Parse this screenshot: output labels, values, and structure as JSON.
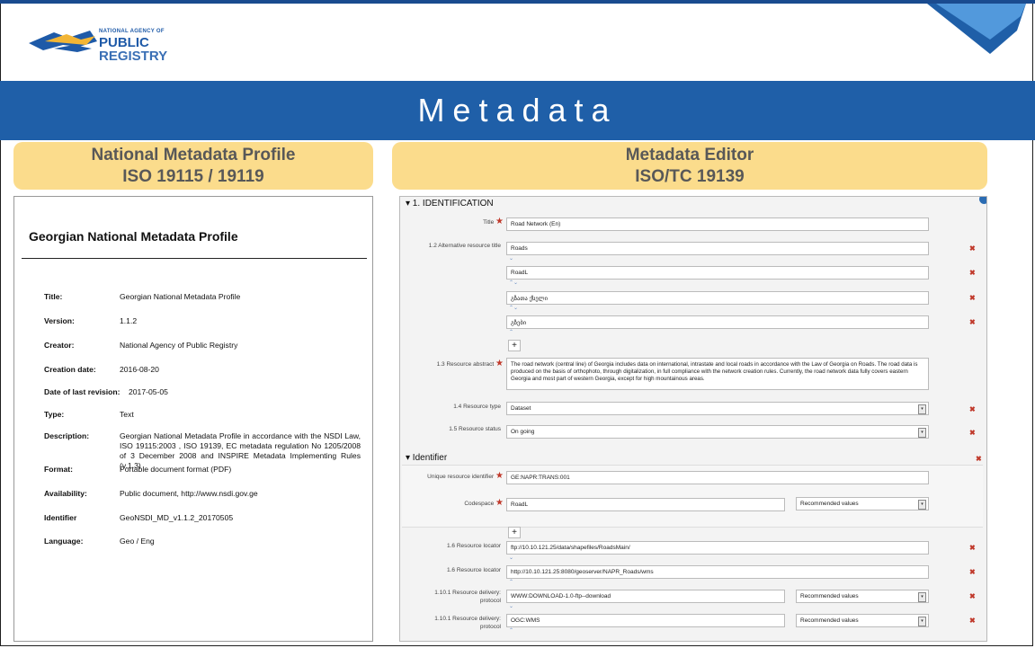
{
  "header": {
    "logo_small": "NATIONAL AGENCY OF",
    "logo_line1": "PUBLIC",
    "logo_line2": "REGISTRY"
  },
  "banner": {
    "title": "Metadata"
  },
  "left_header": {
    "line1": "National Metadata Profile",
    "line2": "ISO 19115 / 19119"
  },
  "right_header": {
    "line1": "Metadata Editor",
    "line2": "ISO/TC 19139"
  },
  "profile_doc": {
    "title": "Georgian National Metadata Profile",
    "rows": [
      {
        "label": "Title:",
        "value": "Georgian National Metadata Profile"
      },
      {
        "label": "Version:",
        "value": "1.1.2"
      },
      {
        "label": "Creator:",
        "value": "National Agency of Public Registry"
      },
      {
        "label": "Creation date:",
        "value": "2016-08-20"
      },
      {
        "label": "Date of last revision:",
        "value": "2017-05-05"
      },
      {
        "label": "Type:",
        "value": "Text"
      },
      {
        "label": "Description:",
        "value": "Georgian National Metadata Profile in accordance with the NSDI Law, ISO 19115:2003 , ISO 19139, EC metadata regulation No 1205/2008 of 3 December 2008 and INSPIRE Metadata Implementing Rules (v.1.3)"
      },
      {
        "label": "Format:",
        "value": "Portable document format (PDF)"
      },
      {
        "label": "Availability:",
        "value": "Public document, http://www.nsdi.gov.ge"
      },
      {
        "label": "Identifier",
        "value": "GeoNSDI_MD_v1.1.2_20170505"
      },
      {
        "label": "Language:",
        "value": "Geo / Eng"
      }
    ]
  },
  "editor": {
    "section_title": "▾ 1. IDENTIFICATION",
    "title_label": "Title",
    "title_value": "Road Network (En)",
    "alt_title_label": "1.2 Alternative resource title",
    "alt_titles": [
      "Roads",
      "RoadL",
      "გზათა ქსელი",
      "გზები"
    ],
    "abstract_label": "1.3 Resource abstract",
    "abstract_value": "The road network (central line) of Georgia includes data on international, intrastate and local roads in accordance with the Law of Georgia on Roads. The road data is produced on the basis of orthophoto, through digitalization, in full compliance with the network creation rules. Currently, the road network data fully covers eastern Georgia and most part of western Georgia, except for high mountainous areas.",
    "type_label": "1.4 Resource type",
    "type_value": "Dataset",
    "status_label": "1.5 Resource status",
    "status_value": "On going",
    "identifier_title": "▾ Identifier",
    "uid_label": "Unique resource identifier",
    "uid_value": "GE:NAPR:TRANS:001",
    "codespace_label": "Codespace",
    "codespace_value": "RoadL",
    "recommended": "Recommended values",
    "locators": [
      {
        "label": "1.6 Resource locator",
        "value": "ftp://10.10.121.25/data/shapefiles/RoadsMain/"
      },
      {
        "label": "1.6 Resource locator",
        "value": "http://10.10.121.25:8080/geoserver/NAPR_Roads/wms"
      }
    ],
    "delivery_label_1": "1.10.1 Resource delivery:",
    "delivery_label_2": "protocol",
    "deliveries": [
      "WWW:DOWNLOAD-1.0-ftp--download",
      "OGC:WMS"
    ],
    "delete_symbol": "✖",
    "plus_symbol": "+"
  },
  "colors": {
    "banner": "#1f5fa8",
    "header_box": "#fbdc8c",
    "required": "#c0392b"
  }
}
